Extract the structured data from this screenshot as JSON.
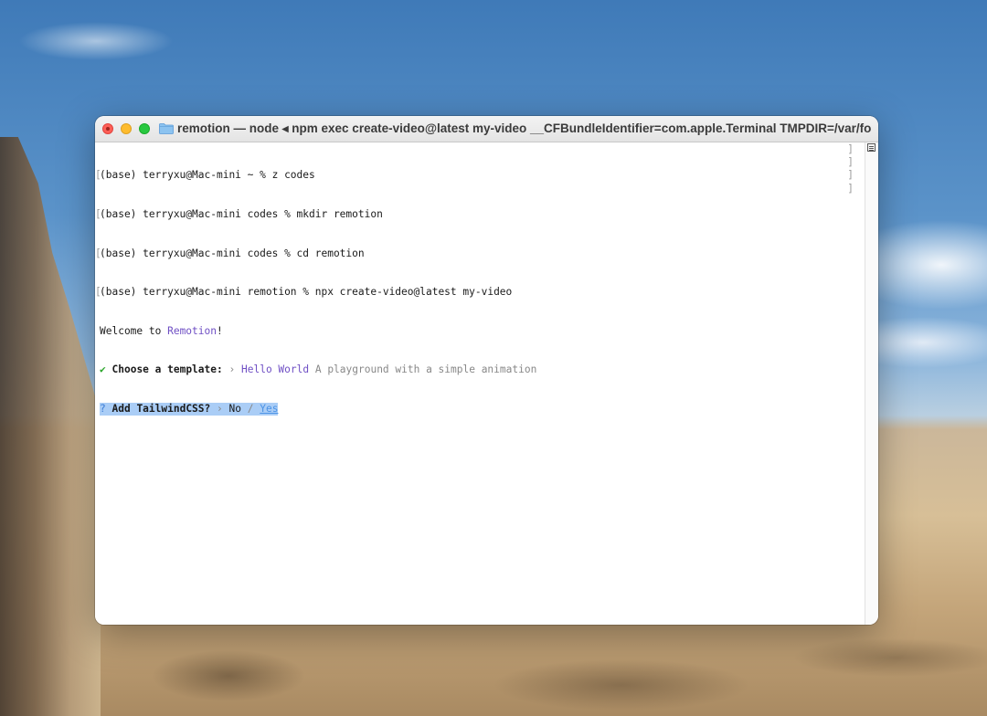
{
  "window": {
    "title": "remotion — node ◂ npm exec create-video@latest my-video __CFBundleIdentifier=com.apple.Terminal TMPDIR=/var/fo...",
    "colors": {
      "close": "#fe5f57",
      "minimize": "#febc2e",
      "maximize": "#28c840"
    }
  },
  "terminal": {
    "commands": [
      "(base) terryxu@Mac-mini ~ % z codes",
      "(base) terryxu@Mac-mini codes % mkdir remotion",
      "(base) terryxu@Mac-mini codes % cd remotion",
      "(base) terryxu@Mac-mini remotion % npx create-video@latest my-video"
    ],
    "welcome": {
      "prefix": "Welcome to ",
      "brand": "Remotion",
      "suffix": "!"
    },
    "template_prompt": {
      "check": "✔",
      "label": "Choose a template:",
      "arrow": "›",
      "value": "Hello World",
      "description": "A playground with a simple animation"
    },
    "tailwind_prompt": {
      "mark": "?",
      "label": "Add TailwindCSS?",
      "arrow": "›",
      "option_no": "No",
      "separator": "/",
      "option_yes": "Yes"
    },
    "accent_colors": {
      "purple": "#6f4fc4",
      "green": "#2aa52a",
      "selection": "#aacdf6",
      "link_blue": "#4b93e6"
    }
  },
  "icons": {
    "folder": "folder-icon",
    "scroll": "scroll-marks-icon"
  }
}
